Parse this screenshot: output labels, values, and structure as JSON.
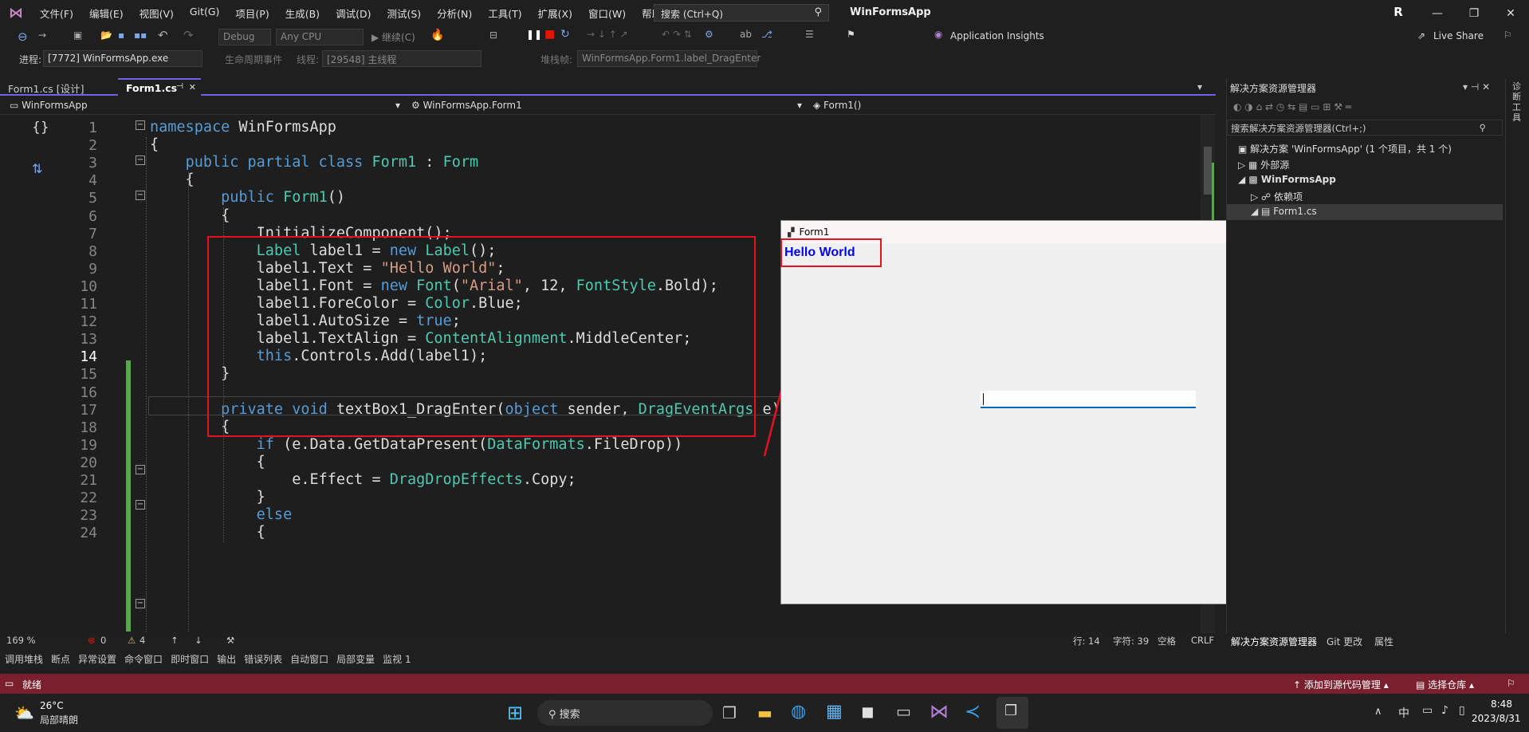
{
  "menu": {
    "items": [
      "文件(F)",
      "编辑(E)",
      "视图(V)",
      "Git(G)",
      "项目(P)",
      "生成(B)",
      "调试(D)",
      "测试(S)",
      "分析(N)",
      "工具(T)",
      "扩展(X)",
      "窗口(W)",
      "帮助(H)"
    ],
    "search_label": "搜索 (Ctrl+Q)",
    "app_title": "WinFormsApp",
    "user_initial": "R"
  },
  "toolbar": {
    "config": "Debug",
    "platform": "Any CPU",
    "continue_label": "继续(C)",
    "app_insights": "Application Insights",
    "live_share": "Live Share",
    "process_label": "进程:",
    "process_value": "[7772] WinFormsApp.exe",
    "lifecycle_label": "生命周期事件",
    "thread_label": "线程:",
    "thread_value": "[29548] 主线程",
    "stack_label": "堆栈帧:",
    "stack_value": "WinFormsApp.Form1.label_DragEnter"
  },
  "tabs": [
    {
      "label": "Form1.cs [设计]"
    },
    {
      "label": "Form1.cs"
    }
  ],
  "navbar": {
    "project": "WinFormsApp",
    "class": "WinFormsApp.Form1",
    "member": "Form1()"
  },
  "lines": [
    {
      "n": "1",
      "tokens": [
        [
          "kw",
          "namespace"
        ],
        [
          "id",
          " WinFormsApp"
        ]
      ]
    },
    {
      "n": "2",
      "tokens": [
        [
          "id",
          "{"
        ]
      ]
    },
    {
      "n": "3",
      "tokens": [
        [
          "id",
          "    "
        ],
        [
          "kw",
          "public partial class"
        ],
        [
          "id",
          " "
        ],
        [
          "ty",
          "Form1"
        ],
        [
          "id",
          " : "
        ],
        [
          "ty",
          "Form"
        ]
      ]
    },
    {
      "n": "4",
      "tokens": [
        [
          "id",
          "    {"
        ]
      ]
    },
    {
      "n": "5",
      "tokens": [
        [
          "id",
          "        "
        ],
        [
          "kw",
          "public"
        ],
        [
          "id",
          " "
        ],
        [
          "ty",
          "Form1"
        ],
        [
          "id",
          "()"
        ]
      ]
    },
    {
      "n": "6",
      "tokens": [
        [
          "id",
          "        {"
        ]
      ]
    },
    {
      "n": "7",
      "tokens": [
        [
          "id",
          "            InitializeComponent();"
        ]
      ]
    },
    {
      "n": "8",
      "tokens": [
        [
          "id",
          "            "
        ],
        [
          "ty",
          "Label"
        ],
        [
          "id",
          " label1 = "
        ],
        [
          "kw",
          "new"
        ],
        [
          "id",
          " "
        ],
        [
          "ty",
          "Label"
        ],
        [
          "id",
          "();"
        ]
      ]
    },
    {
      "n": "9",
      "tokens": [
        [
          "id",
          "            label1.Text = "
        ],
        [
          "st",
          "\"Hello World\""
        ],
        [
          "id",
          ";"
        ]
      ]
    },
    {
      "n": "10",
      "tokens": [
        [
          "id",
          "            label1.Font = "
        ],
        [
          "kw",
          "new"
        ],
        [
          "id",
          " "
        ],
        [
          "ty",
          "Font"
        ],
        [
          "id",
          "("
        ],
        [
          "st",
          "\"Arial\""
        ],
        [
          "id",
          ", 12, "
        ],
        [
          "ty",
          "FontStyle"
        ],
        [
          "id",
          ".Bold);"
        ]
      ]
    },
    {
      "n": "11",
      "tokens": [
        [
          "id",
          "            label1.ForeColor = "
        ],
        [
          "ty",
          "Color"
        ],
        [
          "id",
          ".Blue;"
        ]
      ]
    },
    {
      "n": "12",
      "tokens": [
        [
          "id",
          "            label1.AutoSize = "
        ],
        [
          "kw",
          "true"
        ],
        [
          "id",
          ";"
        ]
      ]
    },
    {
      "n": "13",
      "tokens": [
        [
          "id",
          "            label1.TextAlign = "
        ],
        [
          "ty",
          "ContentAlignment"
        ],
        [
          "id",
          ".MiddleCenter;"
        ]
      ]
    },
    {
      "n": "14",
      "tokens": [
        [
          "id",
          "            "
        ],
        [
          "kw",
          "this"
        ],
        [
          "id",
          ".Controls.Add(label1);"
        ]
      ]
    },
    {
      "n": "15",
      "tokens": [
        [
          "id",
          "        }"
        ]
      ]
    },
    {
      "n": "16",
      "tokens": []
    },
    {
      "n": "17",
      "tokens": [
        [
          "id",
          "        "
        ],
        [
          "kw",
          "private void"
        ],
        [
          "id",
          " textBox1_DragEnter("
        ],
        [
          "kw",
          "object"
        ],
        [
          "id",
          " sender, "
        ],
        [
          "ty",
          "DragEventArgs"
        ],
        [
          "id",
          " e)"
        ]
      ]
    },
    {
      "n": "18",
      "tokens": [
        [
          "id",
          "        {"
        ]
      ]
    },
    {
      "n": "19",
      "tokens": [
        [
          "id",
          "            "
        ],
        [
          "kw",
          "if"
        ],
        [
          "id",
          " (e.Data.GetDataPresent("
        ],
        [
          "ty",
          "DataFormats"
        ],
        [
          "id",
          ".FileDrop))"
        ]
      ]
    },
    {
      "n": "20",
      "tokens": [
        [
          "id",
          "            {"
        ]
      ]
    },
    {
      "n": "21",
      "tokens": [
        [
          "id",
          "                e.Effect = "
        ],
        [
          "ty",
          "DragDropEffects"
        ],
        [
          "id",
          ".Copy;"
        ]
      ]
    },
    {
      "n": "22",
      "tokens": [
        [
          "id",
          "            }"
        ]
      ]
    },
    {
      "n": "23",
      "tokens": [
        [
          "id",
          "            "
        ],
        [
          "kw",
          "else"
        ]
      ]
    },
    {
      "n": "24",
      "tokens": [
        [
          "id",
          "            {"
        ]
      ]
    }
  ],
  "editor_status": {
    "zoom": "169 %",
    "errors": "0",
    "warnings": "4",
    "row": "行: 14",
    "col": "字符: 39",
    "ws": "空格",
    "eol": "CRLF"
  },
  "solution": {
    "title": "解决方案资源管理器",
    "search": "搜索解决方案资源管理器(Ctrl+;)",
    "items": [
      {
        "label": "解决方案 'WinFormsApp' (1 个项目，共 1 个)"
      },
      {
        "label": "外部源"
      },
      {
        "label": "WinFormsApp"
      },
      {
        "label": "依赖项"
      },
      {
        "label": "Form1.cs"
      }
    ],
    "bottom_tabs": [
      "解决方案资源管理器",
      "Git 更改",
      "属性"
    ],
    "side_label": "诊断工具"
  },
  "form1": {
    "title": "Form1",
    "label": "Hello World"
  },
  "panels": [
    "调用堆栈",
    "断点",
    "异常设置",
    "命令窗口",
    "即时窗口",
    "输出",
    "错误列表",
    "自动窗口",
    "局部变量",
    "监视 1"
  ],
  "statusbar": {
    "ready": "就绪",
    "source_control": "添加到源代码管理",
    "repo": "选择仓库"
  },
  "taskbar": {
    "temp": "26°C",
    "weather": "局部晴朗",
    "search": "搜索",
    "ime": "中",
    "time": "8:48",
    "date": "2023/8/31"
  }
}
